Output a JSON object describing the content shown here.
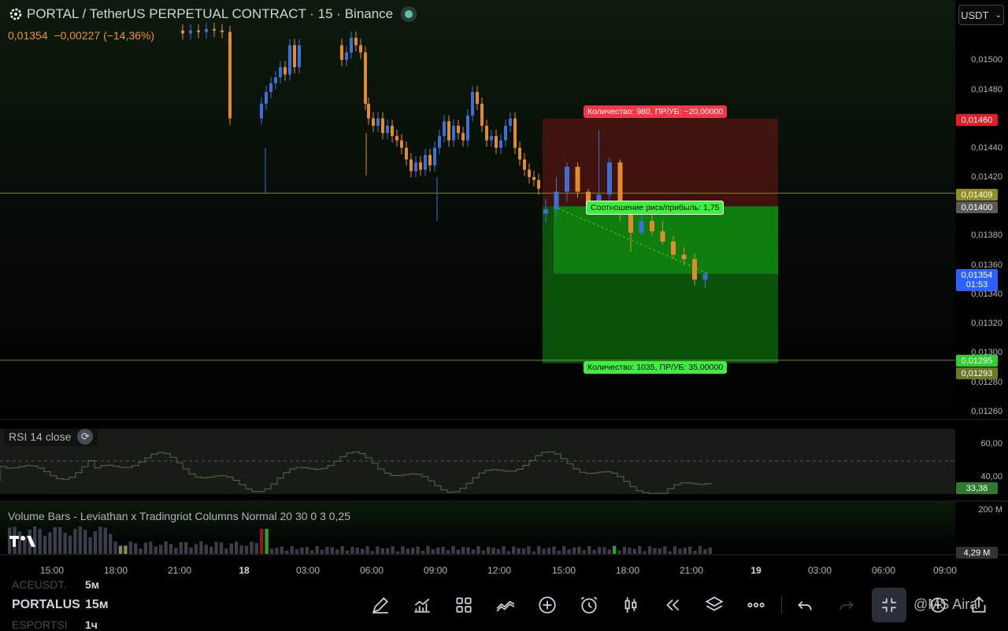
{
  "header": {
    "title": "PORTAL / TetherUS PERPETUAL CONTRACT · 15 · Binance",
    "price": "0,01354",
    "change": "−0,00227 (−14,36%)"
  },
  "currency": {
    "label": "USDT"
  },
  "price_axis": {
    "labels": [
      "0,01500",
      "0,01480",
      "0,01440",
      "0,01420",
      "0,01380",
      "0,01360",
      "0,01340",
      "0,01320",
      "0,01300",
      "0,01280",
      "0,01260"
    ],
    "tags": {
      "stop": "0,01460",
      "line_upper": "0,01409",
      "entry": "0,01400",
      "current": "0,01354",
      "countdown": "01:53",
      "line_lower": "0,01295",
      "target": "0,01293"
    },
    "colors": {
      "stop": "#e81b23",
      "line_upper": "#9b9b20",
      "entry": "#5a5a5a",
      "current": "#2962ff",
      "line_lower": "#2fd12f",
      "target": "#6b7a25"
    }
  },
  "position": {
    "stop_label": "Количество: 980, ПР/УБ: −20,00000",
    "ratio_label": "Соотношение риск/прибыль: 1,75",
    "target_label": "Количество: 1035, ПР/УБ: 35,00000"
  },
  "rsi": {
    "title": "RSI 14 close",
    "labels": [
      "60,00",
      "40,00"
    ],
    "value": "33,38"
  },
  "volume": {
    "title": "Volume Bars - Leviathan x Tradingriot Columns Normal 20 30 0 3 0,25",
    "top_label": "200 M",
    "value": "4,29 M"
  },
  "time_axis": [
    "15:00",
    "18:00",
    "21:00",
    "18",
    "03:00",
    "06:00",
    "09:00",
    "12:00",
    "15:00",
    "18:00",
    "21:00",
    "19",
    "03:00",
    "06:00",
    "09:00"
  ],
  "watchlist": {
    "rows": [
      {
        "symbol": "ACEUSDT.",
        "interval": "5м"
      },
      {
        "symbol": "PORTALUS",
        "interval": "15м"
      },
      {
        "symbol": "ESPORTSI",
        "interval": "1ч"
      }
    ]
  },
  "toolbar": {
    "icons": [
      "pencil-icon",
      "chart-up-icon",
      "grid-icon",
      "trend-icon",
      "plus-circle-icon",
      "alarm-icon",
      "candles-icon",
      "rewind-icon",
      "layers-icon",
      "more-icon",
      "undo-icon",
      "redo-icon",
      "collapse-icon",
      "zoom-icon",
      "share-icon"
    ]
  },
  "watermark": "@MS Aira",
  "chart_data": {
    "type": "candlestick",
    "symbol": "PORTAL / TetherUS PERPETUAL CONTRACT",
    "interval": "15",
    "candles_tail": [
      {
        "o": 0.01395,
        "h": 0.01405,
        "l": 0.01389,
        "c": 0.01398
      },
      {
        "o": 0.01398,
        "h": 0.0142,
        "l": 0.01392,
        "c": 0.0141
      },
      {
        "o": 0.0141,
        "h": 0.0143,
        "l": 0.01403,
        "c": 0.01427
      },
      {
        "o": 0.01427,
        "h": 0.0143,
        "l": 0.01406,
        "c": 0.0141
      },
      {
        "o": 0.0141,
        "h": 0.01412,
        "l": 0.01398,
        "c": 0.01402
      },
      {
        "o": 0.01402,
        "h": 0.01452,
        "l": 0.01398,
        "c": 0.01408
      },
      {
        "o": 0.01408,
        "h": 0.01433,
        "l": 0.014,
        "c": 0.0143
      },
      {
        "o": 0.0143,
        "h": 0.01432,
        "l": 0.0139,
        "c": 0.01395
      },
      {
        "o": 0.01395,
        "h": 0.01398,
        "l": 0.01369,
        "c": 0.01382
      },
      {
        "o": 0.01382,
        "h": 0.01396,
        "l": 0.0138,
        "c": 0.0139
      },
      {
        "o": 0.0139,
        "h": 0.01395,
        "l": 0.0138,
        "c": 0.01383
      },
      {
        "o": 0.01383,
        "h": 0.0139,
        "l": 0.01374,
        "c": 0.01376
      },
      {
        "o": 0.01376,
        "h": 0.0138,
        "l": 0.01364,
        "c": 0.01367
      },
      {
        "o": 0.01367,
        "h": 0.01372,
        "l": 0.0136,
        "c": 0.01364
      },
      {
        "o": 0.01364,
        "h": 0.01368,
        "l": 0.01346,
        "c": 0.0135
      },
      {
        "o": 0.0135,
        "h": 0.01356,
        "l": 0.01344,
        "c": 0.01354
      }
    ],
    "ylim": [
      0.0125,
      0.0152
    ],
    "lines": [
      0.01409,
      0.01295
    ],
    "position": {
      "stop": 0.0146,
      "entry": 0.014,
      "target": 0.01293
    }
  }
}
